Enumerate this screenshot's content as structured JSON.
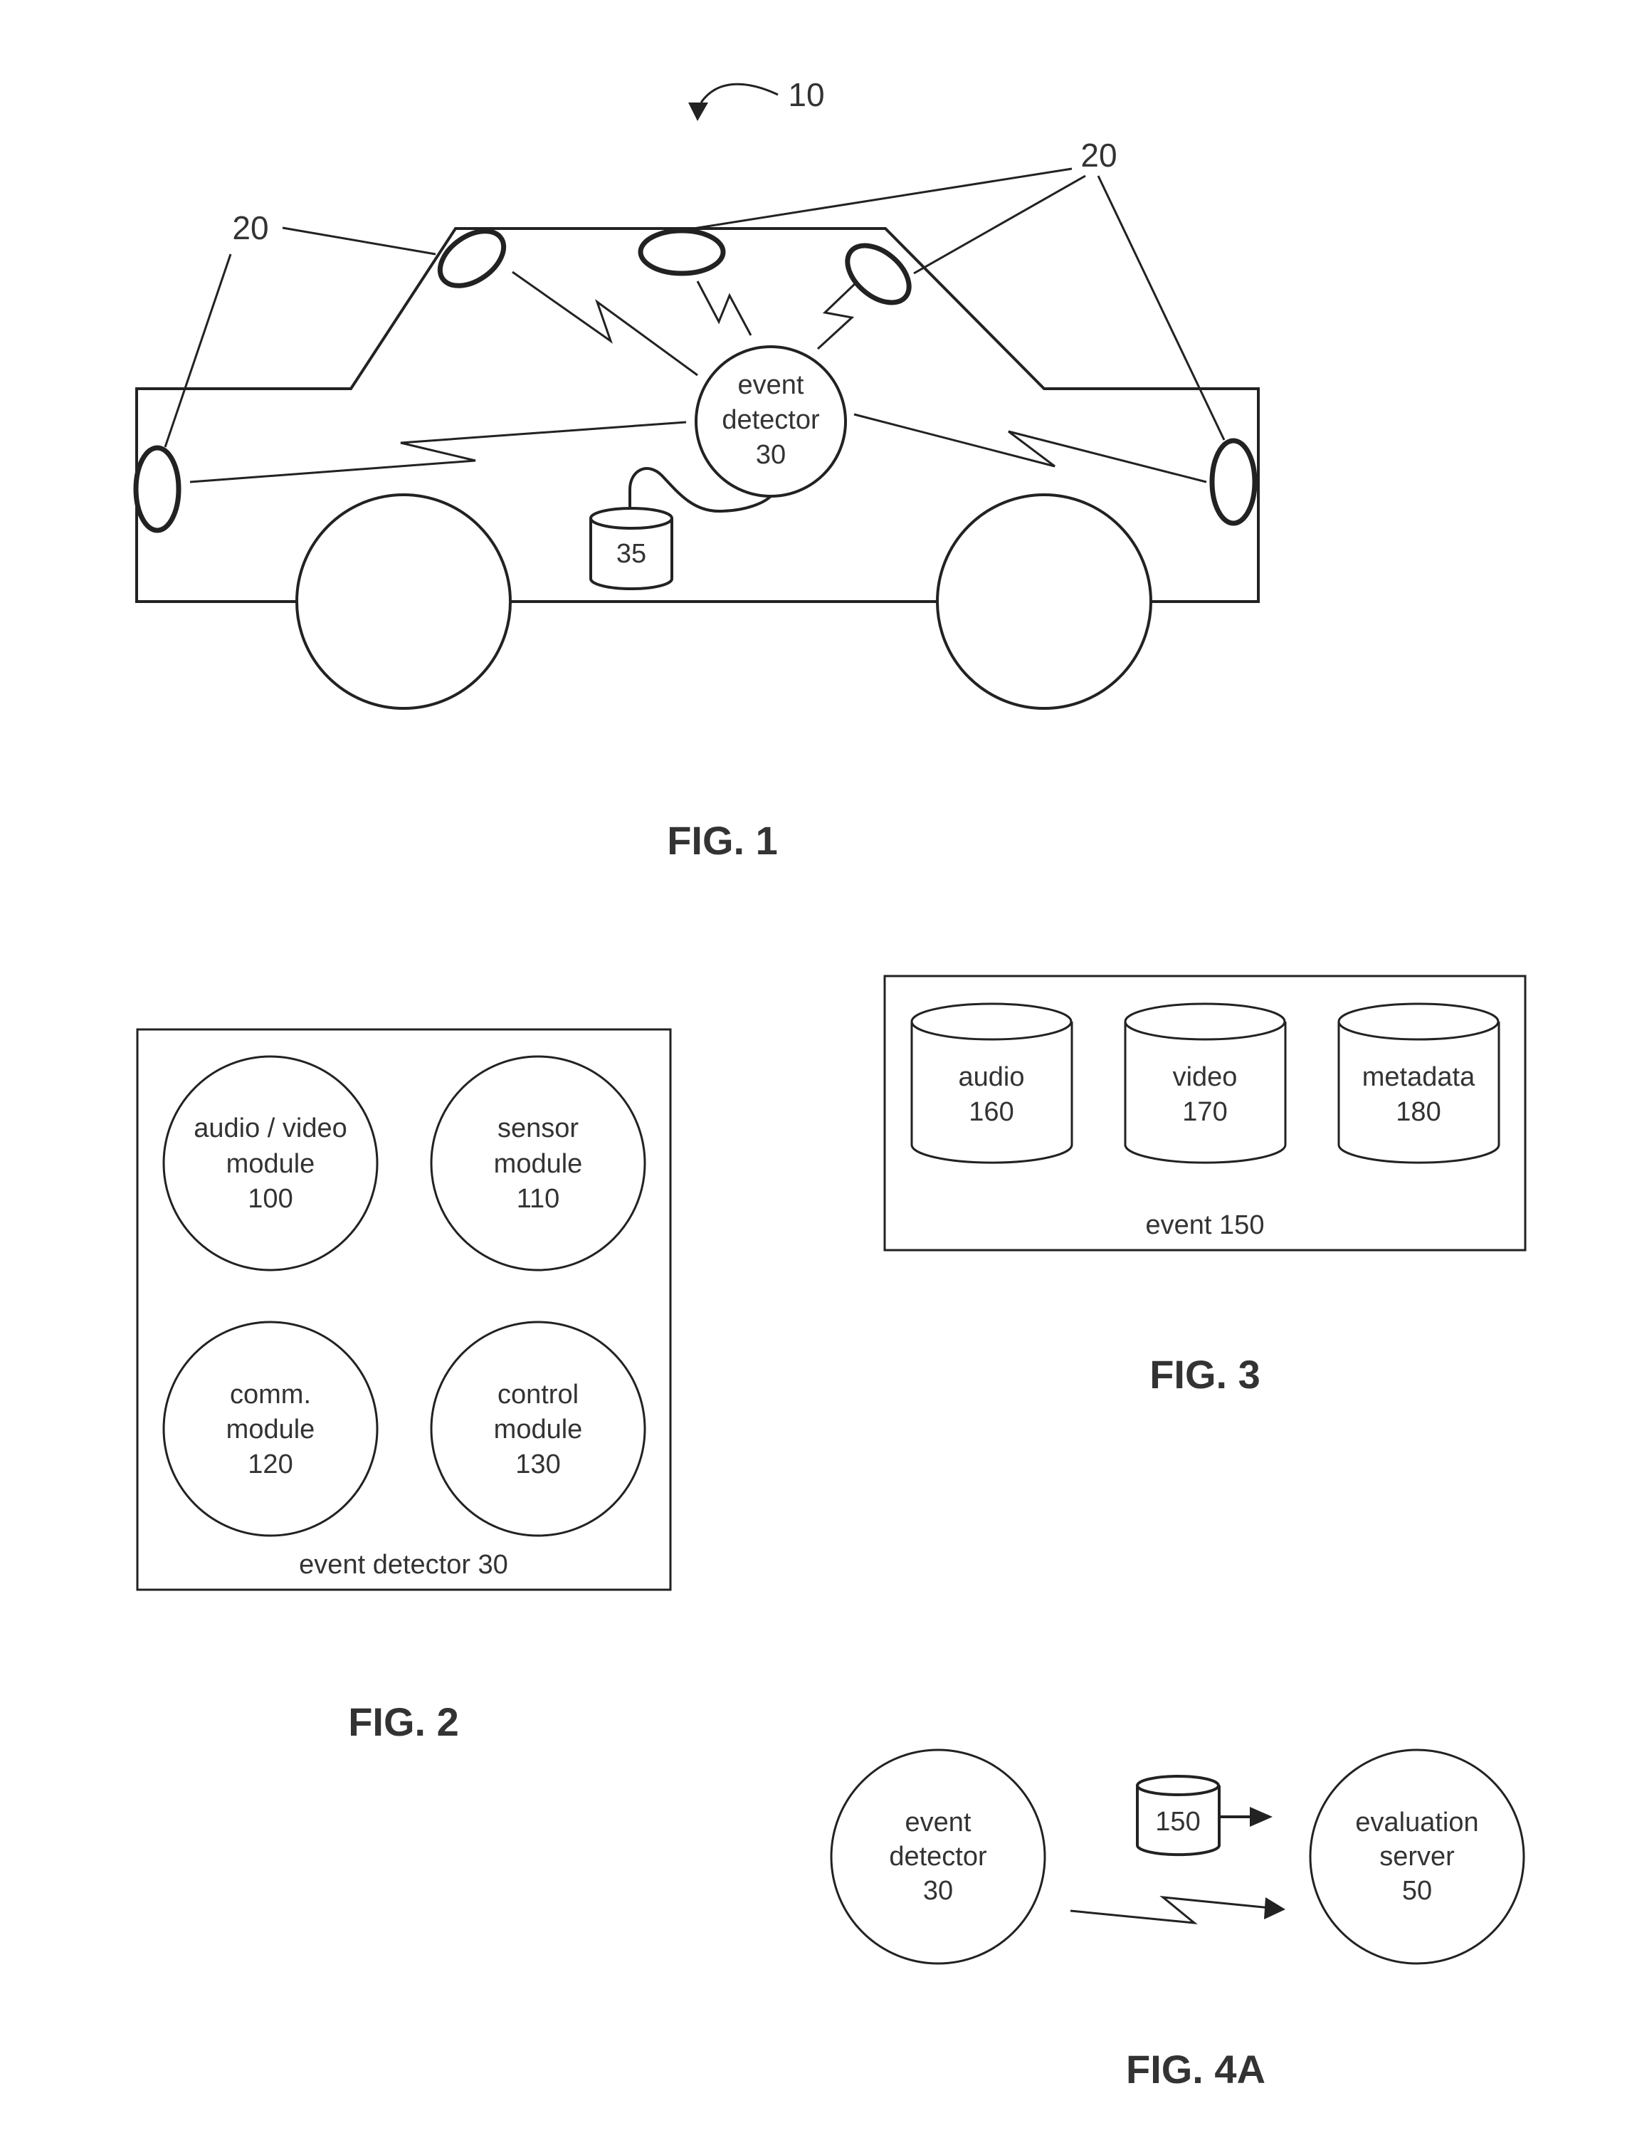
{
  "document": {
    "type": "patent drawing sheet",
    "figures": [
      {
        "id": "fig1",
        "caption": "FIG. 1",
        "reference_numeral": "10",
        "components": {
          "vehicle": {
            "description": "car outline with two wheels"
          },
          "cameras": {
            "reference": "20",
            "count": 5
          },
          "event_detector": {
            "lines": [
              "event",
              "detector",
              "30"
            ]
          },
          "storage": {
            "label": "35"
          }
        },
        "labels": {
          "left_camera_ref": "20",
          "right_camera_ref": "20"
        }
      },
      {
        "id": "fig2",
        "caption": "FIG. 2",
        "container_label": "event detector 30",
        "modules": [
          {
            "lines": [
              "audio / video",
              "module",
              "100"
            ]
          },
          {
            "lines": [
              "sensor",
              "module",
              "110"
            ]
          },
          {
            "lines": [
              "comm.",
              "module",
              "120"
            ]
          },
          {
            "lines": [
              "control",
              "module",
              "130"
            ]
          }
        ]
      },
      {
        "id": "fig3",
        "caption": "FIG. 3",
        "container_label": "event 150",
        "stores": [
          {
            "lines": [
              "audio",
              "160"
            ]
          },
          {
            "lines": [
              "video",
              "170"
            ]
          },
          {
            "lines": [
              "metadata",
              "180"
            ]
          }
        ]
      },
      {
        "id": "fig4a",
        "caption": "FIG. 4A",
        "source": {
          "lines": [
            "event",
            "detector",
            "30"
          ]
        },
        "payload": {
          "label": "150"
        },
        "target": {
          "lines": [
            "evaluation",
            "server",
            "50"
          ]
        }
      }
    ]
  },
  "colors": {
    "ink": "#222222",
    "text": "#333333",
    "paper": "#ffffff"
  }
}
